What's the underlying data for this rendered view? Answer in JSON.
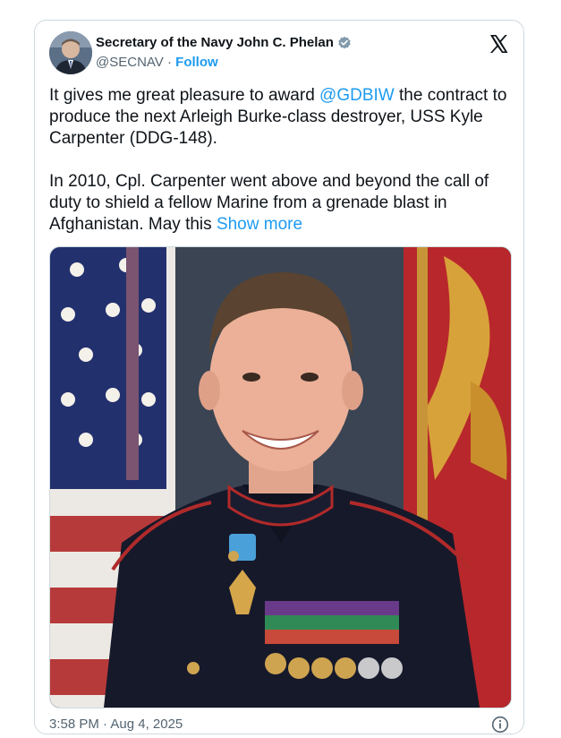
{
  "author": {
    "name": "Secretary of the Navy John C. Phelan",
    "handle": "@SECNAV",
    "separator": "·",
    "follow_label": "Follow"
  },
  "tweet": {
    "para1_prefix": "It gives me great pleasure to award ",
    "para1_mention": "@GDBIW",
    "para1_suffix": " the contract to produce the next Arleigh Burke-class destroyer, USS Kyle Carpenter (DDG-148).",
    "para2": "In 2010, Cpl. Carpenter went above and beyond the call of duty to shield a fellow Marine from a grenade blast in Afghanistan. May this ",
    "show_more": "Show more"
  },
  "footer": {
    "timestamp": "3:58 PM · Aug 4, 2025"
  },
  "colors": {
    "link": "#1d9bf0",
    "secondary_text": "#536471",
    "border": "#cfd9de"
  },
  "icons": [
    "verified-badge-icon",
    "x-logo-icon",
    "info-icon"
  ]
}
